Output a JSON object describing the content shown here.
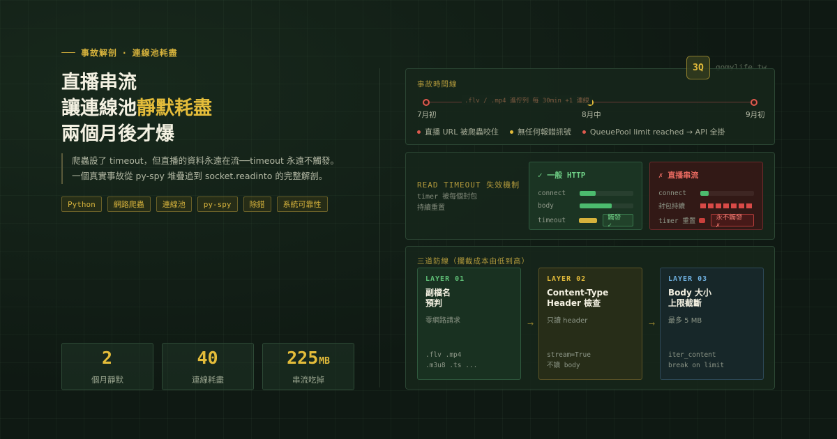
{
  "eyebrow": {
    "part1": "事故解剖",
    "sep": "·",
    "part2": "連線池耗盡"
  },
  "title": {
    "line1": "直播串流",
    "line2_prefix": "讓連線池",
    "line2_highlight": "靜默耗盡",
    "line3": "兩個月後才爆"
  },
  "description": {
    "line1": "爬蟲設了 timeout，但直播的資料永遠在流──timeout 永遠不觸發。",
    "line2": "一個真實事故從 py-spy 堆疊追到 socket.readinto 的完整解剖。"
  },
  "tags": [
    "Python",
    "網路爬蟲",
    "連線池",
    "py-spy",
    "除錯",
    "系統可靠性"
  ],
  "stats": [
    {
      "value": "2",
      "unit": "",
      "label": "個月靜默"
    },
    {
      "value": "40",
      "unit": "",
      "label": "連線耗盡"
    },
    {
      "value": "225",
      "unit": "MB",
      "label": "串流吃掉"
    }
  ],
  "brand": {
    "badge": "3Q",
    "site": "gomylife.tw"
  },
  "timeline": {
    "label": "事故時間線",
    "caption": ".flv / .mp4 進佇列 每 30min +1 連線",
    "dates": [
      "7月初",
      "8月中",
      "9月初"
    ],
    "legend": [
      {
        "text": "直播 URL 被爬蟲咬住",
        "color": "#e05a4e"
      },
      {
        "text": "無任何報錯訊號",
        "color": "#e4bc3a"
      },
      {
        "text": "QueuePool limit reached → API 全掛",
        "color": "#e05a4e"
      }
    ]
  },
  "read_timeout": {
    "title": "READ TIMEOUT 失效機制",
    "sub_line1": "timer 被每個封包",
    "sub_line2": "持續重置",
    "normal": {
      "header": "✓ 一般 HTTP",
      "rows": {
        "connect": "connect",
        "body": "body",
        "timeout": "timeout"
      },
      "chip": "觸發 ✓",
      "connect_level": 0.3,
      "body_level": 0.6,
      "timeout_level": 0.35
    },
    "stream": {
      "header": "✗ 直播串流",
      "rows": {
        "connect": "connect",
        "body": "封包持續",
        "timer": "timer 重置"
      },
      "chip": "永不觸發 ✗",
      "connect_level": 0.15
    }
  },
  "layers": {
    "label": "三道防線（攔截成本由低到高）",
    "arrow": "→",
    "items": [
      {
        "tag": "LAYER 01",
        "title_line1": "副檔名",
        "title_line2": "預判",
        "sub": "零網路請求",
        "code_line1": ".flv .mp4",
        "code_line2": ".m3u8 .ts ..."
      },
      {
        "tag": "LAYER 02",
        "title_line1": "Content-Type",
        "title_line2": "Header 檢查",
        "sub": "只讀 header",
        "code_line1": "stream=True",
        "code_line2": "不讀 body"
      },
      {
        "tag": "LAYER 03",
        "title_line1": "Body 大小",
        "title_line2": "上限截斷",
        "sub": "最多 5 MB",
        "code_line1": "iter_content",
        "code_line2": "break on limit"
      }
    ]
  },
  "colors": {
    "accent": "#e4bc3a",
    "ok": "#6fcf86",
    "danger": "#e05a4e",
    "info": "#6fb0e0"
  }
}
